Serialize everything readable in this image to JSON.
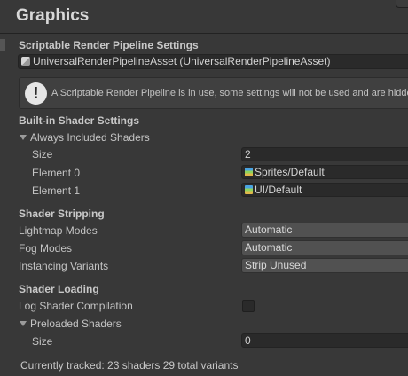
{
  "window": {
    "title": "Graphics"
  },
  "srp": {
    "header": "Scriptable Render Pipeline Settings",
    "asset_value": "UniversalRenderPipelineAsset (UniversalRenderPipelineAsset)",
    "help_text": "A Scriptable Render Pipeline is in use, some settings will not be used and are hidden"
  },
  "builtin_shaders": {
    "header": "Built-in Shader Settings",
    "foldout_label": "Always Included Shaders",
    "size_label": "Size",
    "size_value": "2",
    "elements": [
      {
        "label": "Element 0",
        "value": "Sprites/Default"
      },
      {
        "label": "Element 1",
        "value": "UI/Default"
      }
    ]
  },
  "stripping": {
    "header": "Shader Stripping",
    "lightmap_label": "Lightmap Modes",
    "lightmap_value": "Automatic",
    "fog_label": "Fog Modes",
    "fog_value": "Automatic",
    "instancing_label": "Instancing Variants",
    "instancing_value": "Strip Unused"
  },
  "loading": {
    "header": "Shader Loading",
    "log_label": "Log Shader Compilation",
    "log_checked": false,
    "preloaded_label": "Preloaded Shaders",
    "size_label": "Size",
    "size_value": "0"
  },
  "footer": {
    "tracked_text": "Currently tracked: 23 shaders 29 total variants"
  },
  "icons": [
    "warning-icon",
    "pipeline-asset-icon",
    "shader-asset-icon",
    "foldout-arrow-icon"
  ],
  "colors": {
    "background": "#383838",
    "field": "#2a2a2a",
    "dropdown": "#515151",
    "text": "#c4c4c4"
  }
}
